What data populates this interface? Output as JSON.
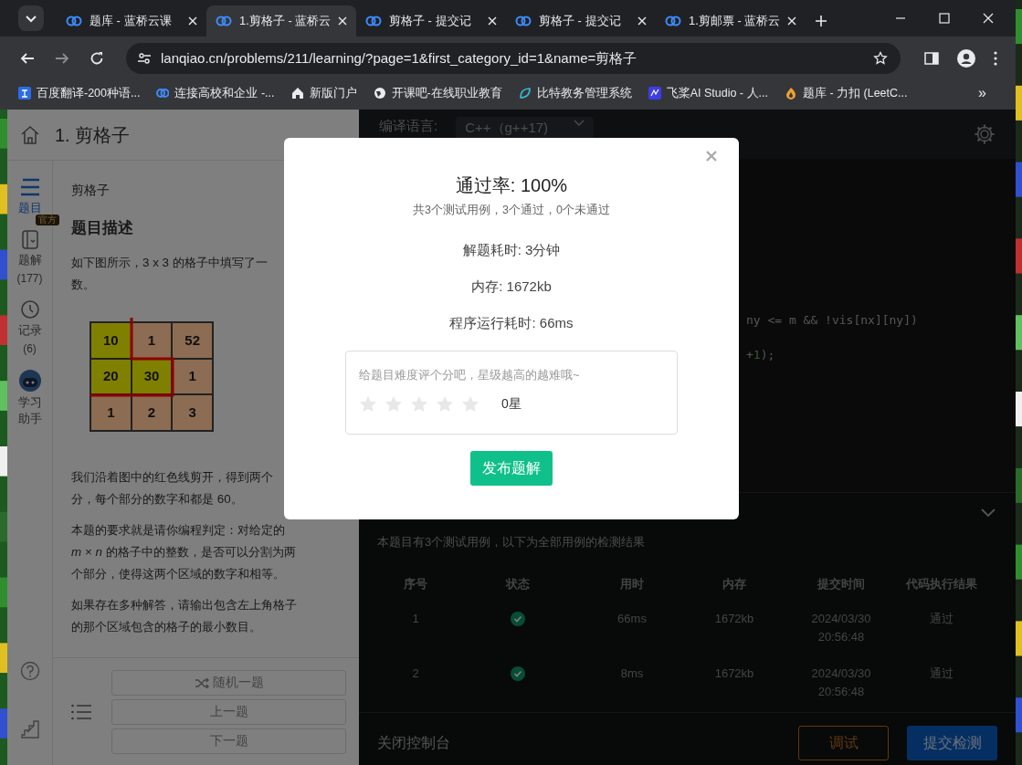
{
  "browser": {
    "tabs": [
      {
        "title": "题库 - 蓝桥云课",
        "selected": false
      },
      {
        "title": "1.剪格子 - 蓝桥云",
        "selected": true
      },
      {
        "title": "剪格子 - 提交记",
        "selected": false
      },
      {
        "title": "剪格子 - 提交记",
        "selected": false
      },
      {
        "title": "1.剪邮票 - 蓝桥云",
        "selected": false
      }
    ],
    "url": "lanqiao.cn/problems/211/learning/?page=1&first_category_id=1&name=剪格子",
    "bookmarks": [
      {
        "label": "百度翻译-200种语..."
      },
      {
        "label": "连接高校和企业 -..."
      },
      {
        "label": "新版门户"
      },
      {
        "label": "开课吧-在线职业教育"
      },
      {
        "label": "比特教务管理系统"
      },
      {
        "label": "飞桨AI Studio - 人..."
      },
      {
        "label": "题库 - 力扣 (LeetC..."
      }
    ],
    "more": "»"
  },
  "problem_panel": {
    "title": "1. 剪格子",
    "sidebar": [
      {
        "label": "题目",
        "selected": true
      },
      {
        "label": "题解",
        "badge": "官方",
        "count": "(177)",
        "selected": false
      },
      {
        "label": "记录",
        "count": "(6)",
        "selected": false
      },
      {
        "label": "学习助手",
        "selected": false
      }
    ],
    "breadcrumb": "剪格子",
    "heading": "题目描述",
    "intro": [
      "如下图所示，3 x 3 的格子中填写了一",
      "数。"
    ],
    "grid": [
      [
        {
          "value": "10",
          "color": "#808000"
        },
        {
          "value": "1",
          "color": "#8c6c52"
        },
        {
          "value": "52",
          "color": "#8c6c52"
        }
      ],
      [
        {
          "value": "20",
          "color": "#808000"
        },
        {
          "value": "30",
          "color": "#808000"
        },
        {
          "value": "1",
          "color": "#8c6c52"
        }
      ],
      [
        {
          "value": "1",
          "color": "#8c6c52"
        },
        {
          "value": "2",
          "color": "#8c6c52"
        },
        {
          "value": "3",
          "color": "#8c6c52"
        }
      ]
    ],
    "paragraphs": [
      [
        "我们沿着图中的红色线剪开，得到两个",
        "分，每个部分的数字和都是 60。"
      ],
      [
        "本题的要求就是请你编程判定：对给定的",
        "*m* × *n* 的格子中的整数，是否可以分割为两",
        "个部分，使得这两个区域的数字和相等。"
      ],
      [
        "如果存在多种解答，请输出包含左上角格子",
        "的那个区域包含的格子的最小数目。"
      ]
    ],
    "nav_buttons": [
      "随机一题",
      "上一题",
      "下一题"
    ]
  },
  "editor_panel": {
    "language_label": "编译语言:",
    "language": "C++（g++17)",
    "code_lines": [
      [
        {
          "text": "ny <= m && !vis[nx][ny])",
          "kind": "plain"
        }
      ],
      [
        {
          "text": "+",
          "kind": "plain"
        },
        {
          "text": "1",
          "kind": "number"
        },
        {
          "text": ");",
          "kind": "plain"
        }
      ]
    ],
    "console": {
      "summary": "本题目有3个测试用例，以下为全部用例的检测结果",
      "columns": [
        "序号",
        "状态",
        "用时",
        "内存",
        "提交时间",
        "代码执行结果"
      ],
      "rows": [
        {
          "index": "1",
          "passed": true,
          "time": "66ms",
          "memory": "1672kb",
          "submitted": [
            "2024/03/30",
            "20:56:48"
          ],
          "result": "通过"
        },
        {
          "index": "2",
          "passed": true,
          "time": "8ms",
          "memory": "1672kb",
          "submitted": [
            "2024/03/30",
            "20:56:48"
          ],
          "result": "通过"
        }
      ]
    },
    "close_console": "关闭控制台",
    "debug_button": "调试",
    "submit_button": "提交检测"
  },
  "result_dialog": {
    "title": "通过率: 100%",
    "summary": "共3个测试用例，3个通过，0个未通过",
    "stats": [
      "解题耗时: 3分钟",
      "内存: 1672kb",
      "程序运行耗时: 66ms"
    ],
    "rating": {
      "prompt": "给题目难度评个分吧，星级越高的越难哦~",
      "stars": 0,
      "reading": "0星"
    },
    "publish_button": "发布题解"
  }
}
